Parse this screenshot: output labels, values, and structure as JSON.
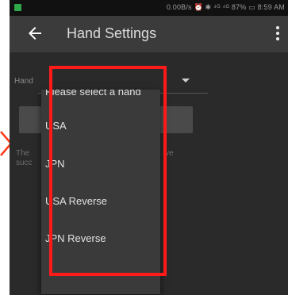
{
  "status_bar": {
    "text": "0.00B/s ⏰ ✱ ⁴ᴳ ⁴ᴳ 87% ▭ 8:59 AM"
  },
  "app_bar": {
    "title": "Hand Settings"
  },
  "form": {
    "hand_label": "Hand",
    "background_text_line1_left": "The",
    "background_text_line1_right": "ve",
    "background_text_line2_left": "succ"
  },
  "dropdown": {
    "placeholder_option": "Please select a hand",
    "options": [
      "USA",
      "JPN",
      "USA Reverse",
      "JPN Reverse"
    ]
  },
  "colors": {
    "highlight": "#ff1a1a",
    "status_icon": "#2ea84a"
  },
  "icons": {
    "back": "arrow-left-icon",
    "more": "more-vert-icon",
    "caret": "caret-down-icon",
    "pointer": "chevron-right-icon"
  }
}
